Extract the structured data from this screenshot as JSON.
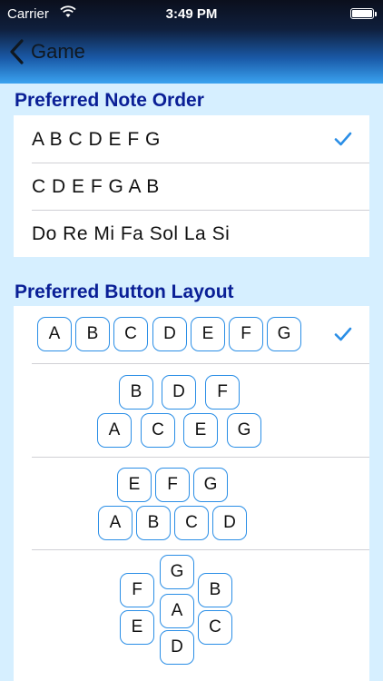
{
  "status_bar": {
    "carrier": "Carrier",
    "time": "3:49 PM"
  },
  "nav": {
    "back_label": "Game"
  },
  "note_order": {
    "title": "Preferred Note Order",
    "options": [
      {
        "label": "A B C D E F G",
        "selected": true
      },
      {
        "label": "C D E F G A B",
        "selected": false
      },
      {
        "label": "Do Re Mi Fa Sol La Si",
        "selected": false
      }
    ]
  },
  "button_layout": {
    "title": "Preferred Button Layout",
    "layouts": [
      {
        "selected": true,
        "keys": [
          "A",
          "B",
          "C",
          "D",
          "E",
          "F",
          "G"
        ]
      },
      {
        "selected": false,
        "keys": [
          "B",
          "D",
          "F",
          "A",
          "C",
          "E",
          "G"
        ]
      },
      {
        "selected": false,
        "keys": [
          "E",
          "F",
          "G",
          "A",
          "B",
          "C",
          "D"
        ]
      },
      {
        "selected": false,
        "keys": [
          "G",
          "F",
          "B",
          "A",
          "E",
          "C",
          "D"
        ]
      }
    ]
  },
  "colors": {
    "accent": "#2a8ee6",
    "section_title": "#0a1f96",
    "background": "#d6efff"
  }
}
